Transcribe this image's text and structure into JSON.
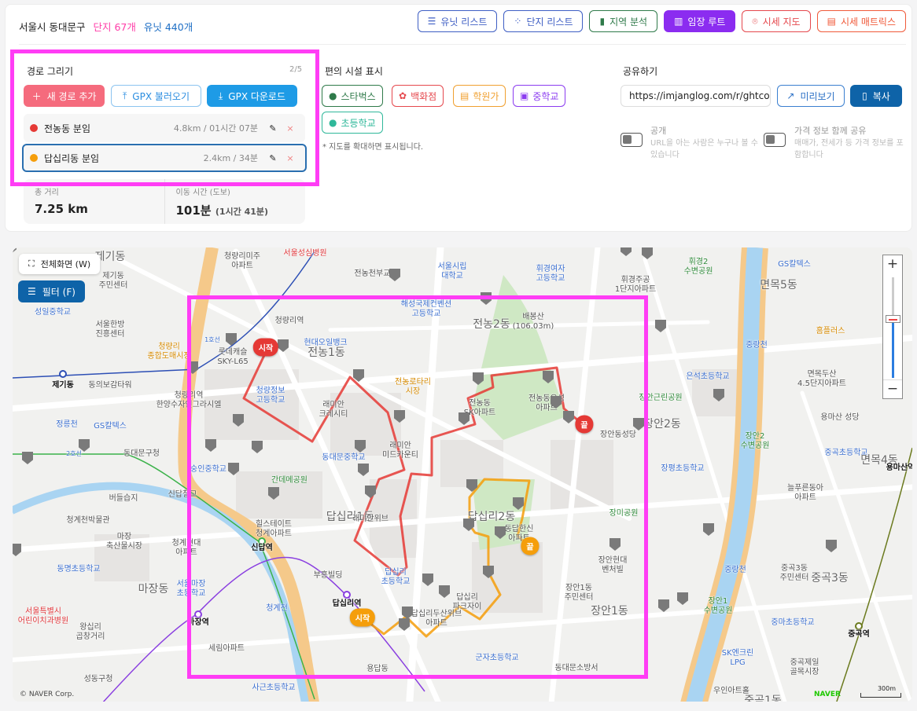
{
  "header": {
    "region": "서울시 동대문구",
    "complex_count": "단지 67개",
    "unit_count": "유닛 440개"
  },
  "nav": [
    {
      "label": "유닛 리스트",
      "icon": "list-icon",
      "color": "#3f5fc4",
      "active": false
    },
    {
      "label": "단지 리스트",
      "icon": "grid-icon",
      "color": "#3f5fc4",
      "active": false
    },
    {
      "label": "지역 분석",
      "icon": "bar-chart-icon",
      "color": "#2f7a4a",
      "active": false
    },
    {
      "label": "임장 루트",
      "icon": "map-icon",
      "color": "#8b2cf0",
      "active": true
    },
    {
      "label": "시세 지도",
      "icon": "pin-icon",
      "color": "#e5484d",
      "active": false
    },
    {
      "label": "시세 매트릭스",
      "icon": "table-icon",
      "color": "#f05a3a",
      "active": false
    }
  ],
  "route_panel": {
    "title": "경로 그리기",
    "count": "2/5",
    "add_label": "새 경로 추가",
    "import_label": "GPX 불러오기",
    "download_label": "GPX 다운로드",
    "routes": [
      {
        "name": "전농동 분임",
        "meta": "4.8km / 01시간 07분",
        "color": "#e53935",
        "selected": false
      },
      {
        "name": "답십리동 분임",
        "meta": "2.4km / 34분",
        "color": "#f59e0b",
        "selected": true
      }
    ],
    "total_distance_label": "총 거리",
    "total_distance": "7.25 km",
    "walk_time_label": "이동 시간 (도보)",
    "walk_time": "101분",
    "walk_time_detail": "(1시간 41분)"
  },
  "facilities": {
    "title": "편의 시설 표시",
    "chips": [
      {
        "label": "스타벅스",
        "color": "#2f7a4a",
        "icon": "starbucks-icon"
      },
      {
        "label": "백화점",
        "color": "#e5484d",
        "icon": "flower-icon"
      },
      {
        "label": "학원가",
        "color": "#f0a030",
        "icon": "books-icon"
      },
      {
        "label": "중학교",
        "color": "#8b3cf0",
        "icon": "school-icon"
      },
      {
        "label": "초등학교",
        "color": "#2fb89a",
        "icon": "backpack-icon"
      }
    ],
    "note": "* 지도를 확대하면 표시됩니다."
  },
  "share": {
    "title": "공유하기",
    "url": "https://imjanglog.com/r/ghtcoa",
    "preview_label": "미리보기",
    "copy_label": "복사",
    "public_title": "공개",
    "public_desc": "URL을 아는 사람은 누구나 볼 수 있습니다",
    "public_on": false,
    "price_title": "가격 정보 함께 공유",
    "price_desc": "매매가, 전세가 등 가격 정보를 포함합니다",
    "price_on": false
  },
  "map": {
    "fullscreen_label": "전체화면 (W)",
    "filter_label": "필터 (F)",
    "copyright": "© NAVER Corp.",
    "brand": "NAVER",
    "scale": "300m",
    "start_label": "시작",
    "end_label": "끝",
    "zoom_level": 0.55,
    "line_labels": [
      "1호선",
      "2호선"
    ],
    "labels": [
      {
        "t": "제기동",
        "c": "dist"
      },
      {
        "t": "청량리미주\n아파트",
        "c": ""
      },
      {
        "t": "서울성심병원",
        "c": "red"
      },
      {
        "t": "제기동\n주민센터",
        "c": ""
      },
      {
        "t": "성일중학교",
        "c": "blue"
      },
      {
        "t": "서울한방\n진흥센터",
        "c": ""
      },
      {
        "t": "청량리\n종합도매시장",
        "c": "orange"
      },
      {
        "t": "제기동",
        "c": "stn"
      },
      {
        "t": "동의보감타워",
        "c": ""
      },
      {
        "t": "정릉천",
        "c": "blue"
      },
      {
        "t": "GS칼텍스",
        "c": "blue"
      },
      {
        "t": "동대문구청",
        "c": ""
      },
      {
        "t": "청량리역",
        "c": ""
      },
      {
        "t": "롯데캐슬\nSKY-L65",
        "c": ""
      },
      {
        "t": "청량정보\n고등학교",
        "c": "blue"
      },
      {
        "t": "청량리역\n한양수자인그라시엘",
        "c": ""
      },
      {
        "t": "숭인중학교",
        "c": "blue"
      },
      {
        "t": "간데메공원",
        "c": "green"
      },
      {
        "t": "현대오일뱅크",
        "c": "blue"
      },
      {
        "t": "전농1동",
        "c": "dist"
      },
      {
        "t": "해성국제컨벤션\n고등학교",
        "c": "blue"
      },
      {
        "t": "서울시립\n대학교",
        "c": "blue"
      },
      {
        "t": "전농천부교회",
        "c": ""
      },
      {
        "t": "전농2동",
        "c": "dist"
      },
      {
        "t": "배봉산\n(106.03m)",
        "c": ""
      },
      {
        "t": "휘경여자\n고등학교",
        "c": "blue"
      },
      {
        "t": "휘경2\n수변공원",
        "c": "green"
      },
      {
        "t": "휘경주공\n1단지아파트",
        "c": ""
      },
      {
        "t": "면목5동",
        "c": "dist"
      },
      {
        "t": "GS칼텍스",
        "c": "blue"
      },
      {
        "t": "홈플러스",
        "c": "orange"
      },
      {
        "t": "중랑천",
        "c": "blue"
      },
      {
        "t": "은석초등학교",
        "c": "blue"
      },
      {
        "t": "면목두산\n4.5단지아파트",
        "c": ""
      },
      {
        "t": "장안근린공원",
        "c": "green"
      },
      {
        "t": "장안2동",
        "c": "dist"
      },
      {
        "t": "장안동성당",
        "c": ""
      },
      {
        "t": "용마산 성당",
        "c": ""
      },
      {
        "t": "장안2\n수변공원",
        "c": "green"
      },
      {
        "t": "중곡초등학교",
        "c": "blue"
      },
      {
        "t": "면목4동",
        "c": "dist"
      },
      {
        "t": "용마산역",
        "c": "stn"
      },
      {
        "t": "장평초등학교",
        "c": "blue"
      },
      {
        "t": "늘푸른동아\n아파트",
        "c": ""
      },
      {
        "t": "장미공원",
        "c": "green"
      },
      {
        "t": "전농로타리\n시장",
        "c": "orange"
      },
      {
        "t": "래미안\n크레시티",
        "c": ""
      },
      {
        "t": "래미안\n미드카운티",
        "c": ""
      },
      {
        "t": "동대문중학교",
        "c": "blue"
      },
      {
        "t": "전농동\nSK아파트",
        "c": ""
      },
      {
        "t": "전농동우성\n아파트",
        "c": ""
      },
      {
        "t": "힐스테이트\n청계아파트",
        "c": ""
      },
      {
        "t": "신답철교",
        "c": ""
      },
      {
        "t": "버들습지",
        "c": ""
      },
      {
        "t": "청계천박물관",
        "c": ""
      },
      {
        "t": "마장\n축산물시장",
        "c": ""
      },
      {
        "t": "청계현대\n아파트",
        "c": ""
      },
      {
        "t": "동명초등학교",
        "c": "blue"
      },
      {
        "t": "신답역",
        "c": "stn"
      },
      {
        "t": "답십리1동",
        "c": "dist"
      },
      {
        "t": "래미안위브",
        "c": ""
      },
      {
        "t": "답십리2동",
        "c": "dist"
      },
      {
        "t": "동답한신\n아파트",
        "c": ""
      },
      {
        "t": "부흥빌딩",
        "c": ""
      },
      {
        "t": "답십리\n초등학교",
        "c": "blue"
      },
      {
        "t": "장안현대\n벤처빌",
        "c": ""
      },
      {
        "t": "마장동",
        "c": "dist"
      },
      {
        "t": "서울마장\n초등학교",
        "c": "blue"
      },
      {
        "t": "서울특별시\n어린이치과병원",
        "c": "red"
      },
      {
        "t": "왕십리\n곱창거리",
        "c": ""
      },
      {
        "t": "마장역",
        "c": "stn"
      },
      {
        "t": "청계천",
        "c": "blue"
      },
      {
        "t": "답십리역",
        "c": "stn"
      },
      {
        "t": "답십리\n파크자이",
        "c": ""
      },
      {
        "t": "장안1동\n주민센터",
        "c": ""
      },
      {
        "t": "장안1동",
        "c": "dist"
      },
      {
        "t": "답십리두산위브\n아파트",
        "c": ""
      },
      {
        "t": "세림아파트",
        "c": ""
      },
      {
        "t": "중랑천",
        "c": "blue"
      },
      {
        "t": "장안1\n수변공원",
        "c": "green"
      },
      {
        "t": "중곡3동\n주민센터",
        "c": ""
      },
      {
        "t": "중곡3동",
        "c": "dist"
      },
      {
        "t": "중마초등학교",
        "c": "blue"
      },
      {
        "t": "SK엔크린\nLPG",
        "c": "blue"
      },
      {
        "t": "중곡역",
        "c": "stn"
      },
      {
        "t": "중곡제일\n골목시장",
        "c": ""
      },
      {
        "t": "성동구청",
        "c": ""
      },
      {
        "t": "사근초등학교",
        "c": "blue"
      },
      {
        "t": "군자초등학교",
        "c": "blue"
      },
      {
        "t": "동대문소방서",
        "c": ""
      },
      {
        "t": "용답동",
        "c": ""
      },
      {
        "t": "우인아트홀",
        "c": ""
      },
      {
        "t": "중곡1동",
        "c": "dist"
      }
    ]
  }
}
